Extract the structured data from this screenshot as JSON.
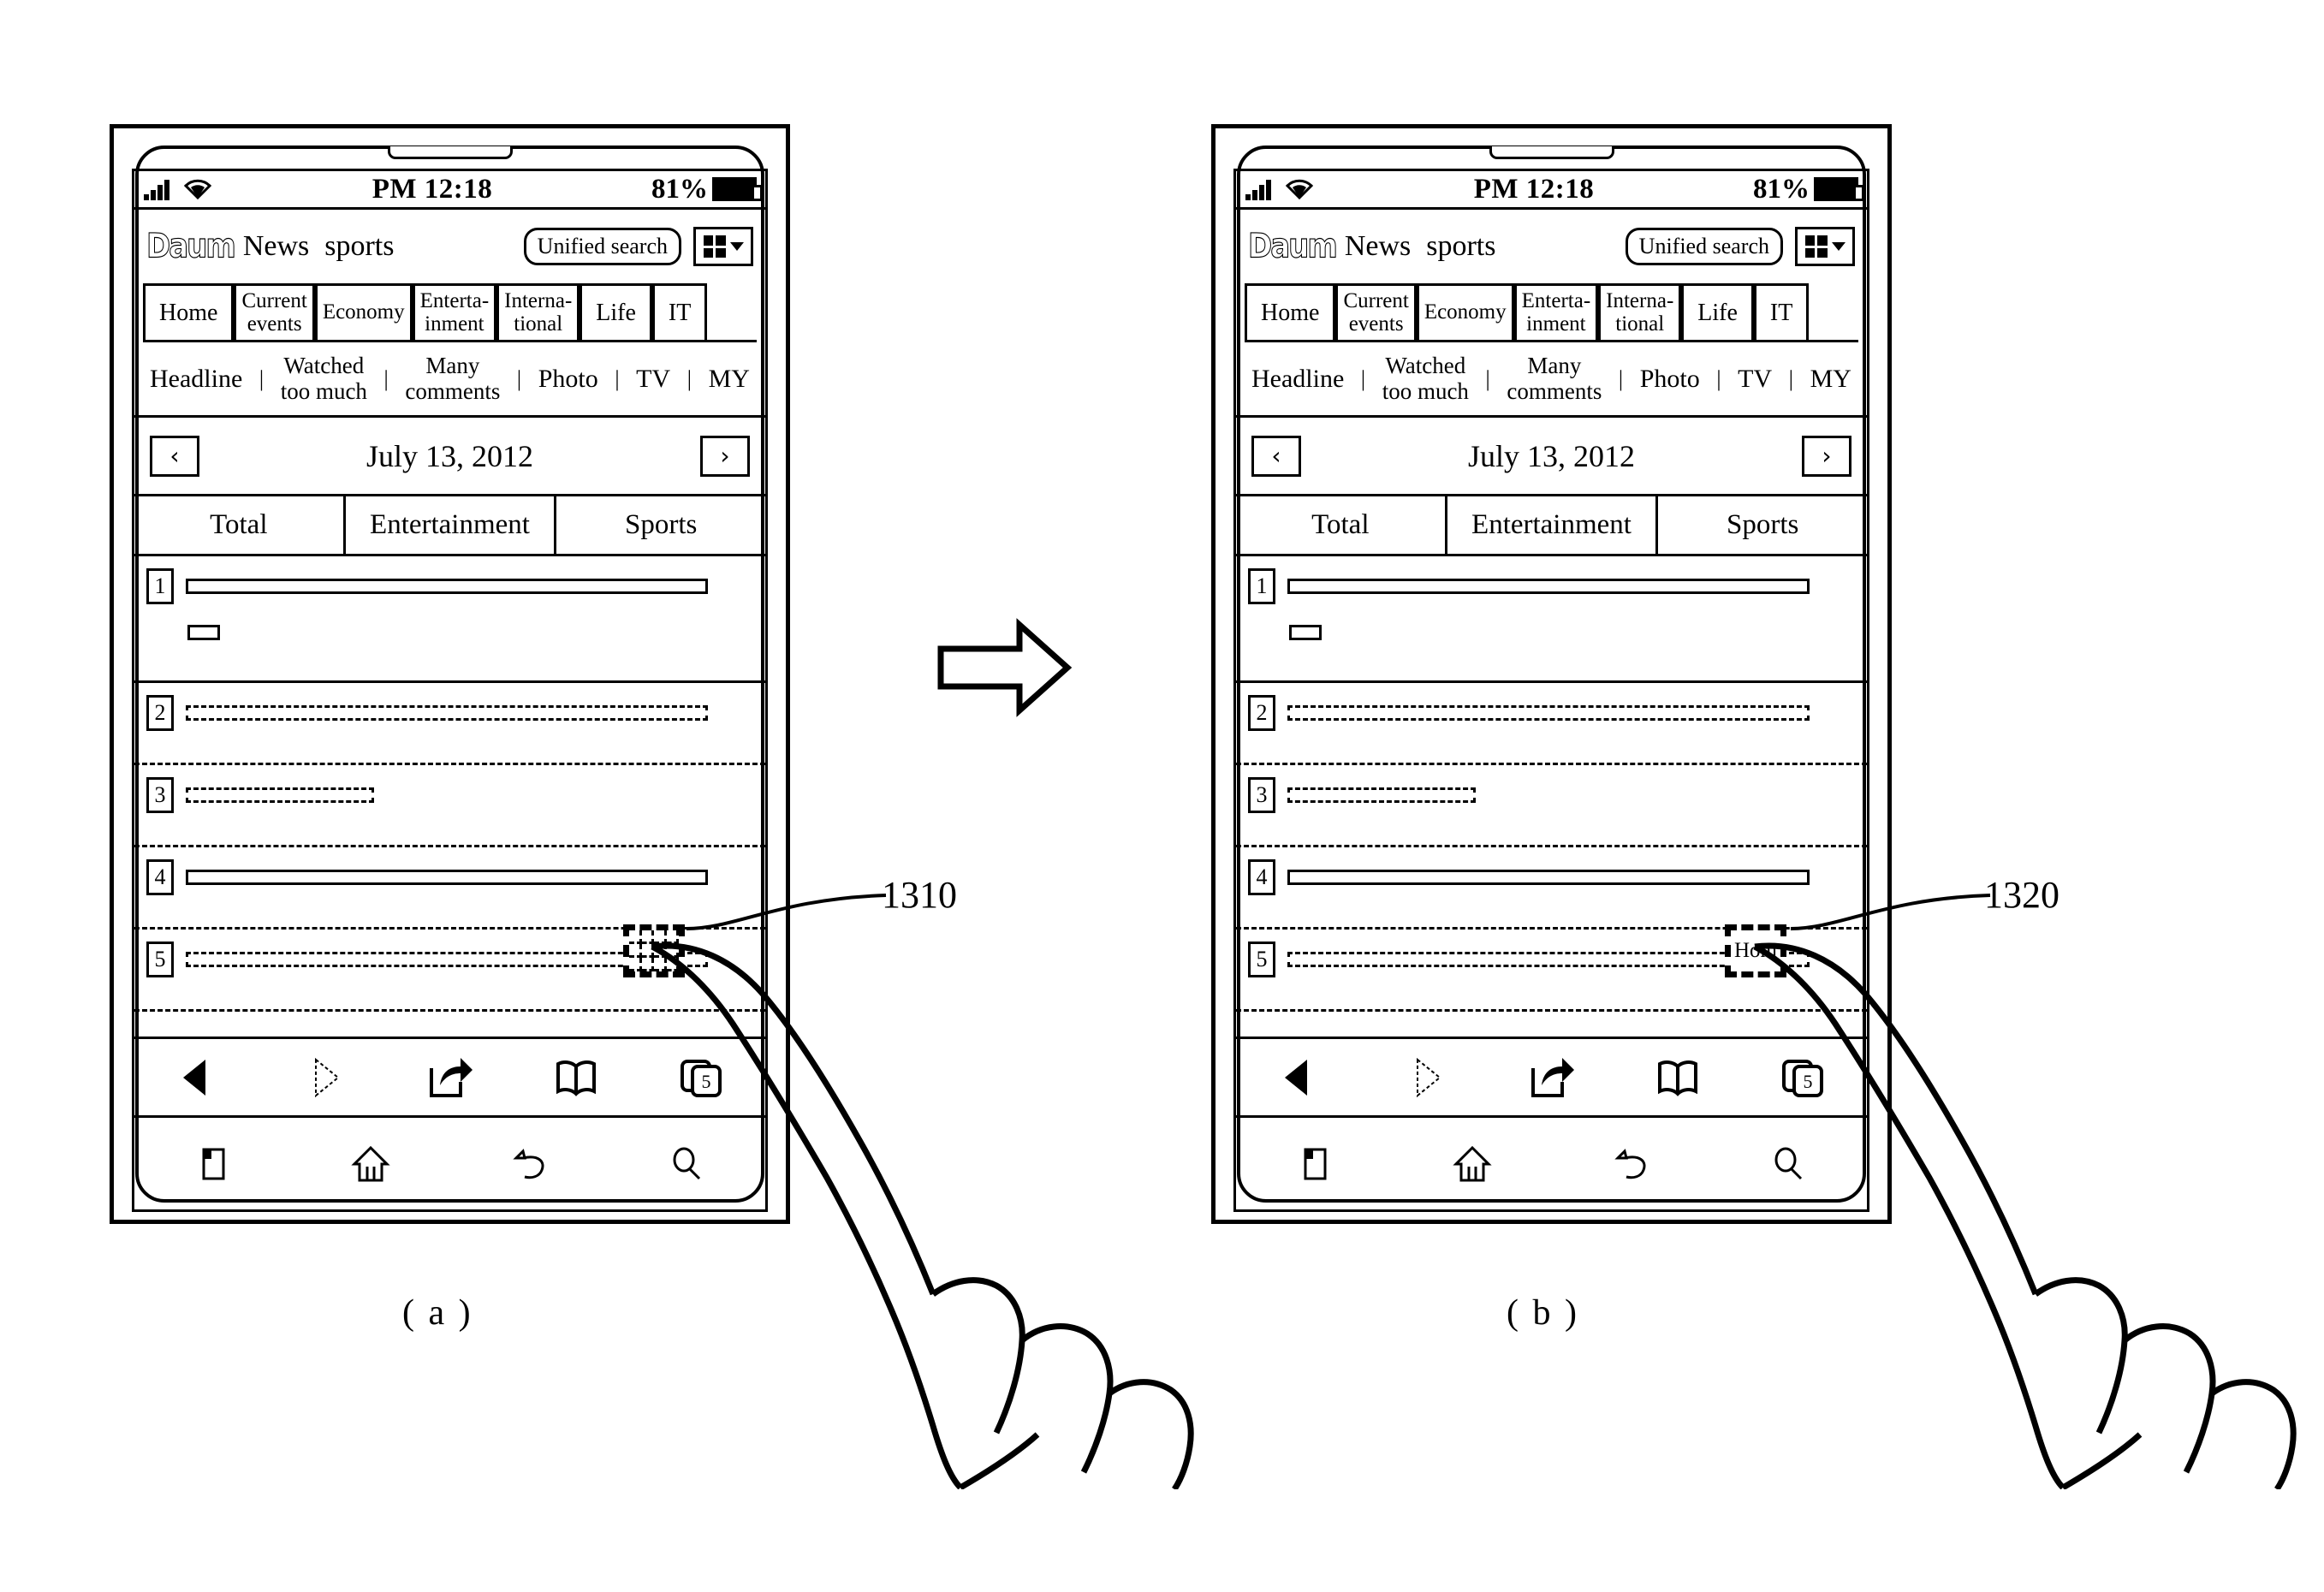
{
  "figure": {
    "panel_a_label": "( a )",
    "panel_b_label": "( b )",
    "callout_a": "1310",
    "callout_b": "1320",
    "arrow": "flow-arrow-right"
  },
  "status_bar": {
    "signal_icon": "signal-bars-icon",
    "wifi_icon": "wifi-icon",
    "time": "PM 12:18",
    "battery_percent": "81%",
    "battery_icon": "battery-icon"
  },
  "site_header": {
    "logo": "Daum",
    "section_primary": "News",
    "section_secondary": "sports",
    "unified_search_label": "Unified search",
    "grid_menu_icon": "grid-menu-icon",
    "caret_icon": "chevron-down-icon"
  },
  "category_tabs": [
    {
      "label": "Home",
      "active": true,
      "lines": [
        "Home"
      ]
    },
    {
      "label": "Current events",
      "active": false,
      "lines": [
        "Current",
        "events"
      ]
    },
    {
      "label": "Economy",
      "active": false,
      "lines": [
        "Economy"
      ]
    },
    {
      "label": "Entertainment",
      "active": false,
      "lines": [
        "Enterta-",
        "inment"
      ]
    },
    {
      "label": "International",
      "active": false,
      "lines": [
        "Interna-",
        "tional"
      ]
    },
    {
      "label": "Life",
      "active": false,
      "lines": [
        "Life"
      ]
    },
    {
      "label": "IT",
      "active": false,
      "lines": [
        "IT"
      ]
    }
  ],
  "sub_nav": [
    {
      "label": "Headline",
      "lines": [
        "Headline"
      ]
    },
    {
      "label": "Watched too much",
      "lines": [
        "Watched",
        "too much"
      ]
    },
    {
      "label": "Many comments",
      "lines": [
        "Many",
        "comments"
      ]
    },
    {
      "label": "Photo",
      "lines": [
        "Photo"
      ]
    },
    {
      "label": "TV",
      "lines": [
        "TV"
      ]
    },
    {
      "label": "MY",
      "lines": [
        "MY"
      ]
    }
  ],
  "sub_nav_separator": "|",
  "date_bar": {
    "prev_label": "‹",
    "date": "July 13, 2012",
    "next_label": "›"
  },
  "segment_tabs": [
    {
      "label": "Total",
      "active": true
    },
    {
      "label": "Entertainment",
      "active": false
    },
    {
      "label": "Sports",
      "active": false
    }
  ],
  "ranking_list": [
    {
      "rank": "1",
      "bar_width_pct": 92,
      "bar_style": "solid",
      "has_sub_box": true
    },
    {
      "rank": "2",
      "bar_width_pct": 92,
      "bar_style": "dashed",
      "has_sub_box": false
    },
    {
      "rank": "3",
      "bar_width_pct": 33,
      "bar_style": "dashed",
      "has_sub_box": false
    },
    {
      "rank": "4",
      "bar_width_pct": 92,
      "bar_style": "solid",
      "has_sub_box": false
    },
    {
      "rank": "5",
      "bar_width_pct": 92,
      "bar_style": "dashed",
      "has_sub_box": false
    }
  ],
  "browser_toolbar": [
    {
      "name": "back-icon",
      "state": "enabled"
    },
    {
      "name": "forward-icon",
      "state": "disabled"
    },
    {
      "name": "share-icon",
      "state": "enabled"
    },
    {
      "name": "bookmarks-icon",
      "state": "enabled"
    },
    {
      "name": "tabs-icon",
      "state": "enabled",
      "badge": "5"
    }
  ],
  "system_nav": [
    {
      "name": "menu-icon"
    },
    {
      "name": "home-icon"
    },
    {
      "name": "back-icon"
    },
    {
      "name": "search-icon"
    }
  ],
  "overlay_a": {
    "kind": "mesh-grid-overlay",
    "text": ""
  },
  "overlay_b": {
    "kind": "text-label-overlay",
    "text": "Hom"
  },
  "colors": {
    "ink": "#000000",
    "paper": "#ffffff"
  }
}
